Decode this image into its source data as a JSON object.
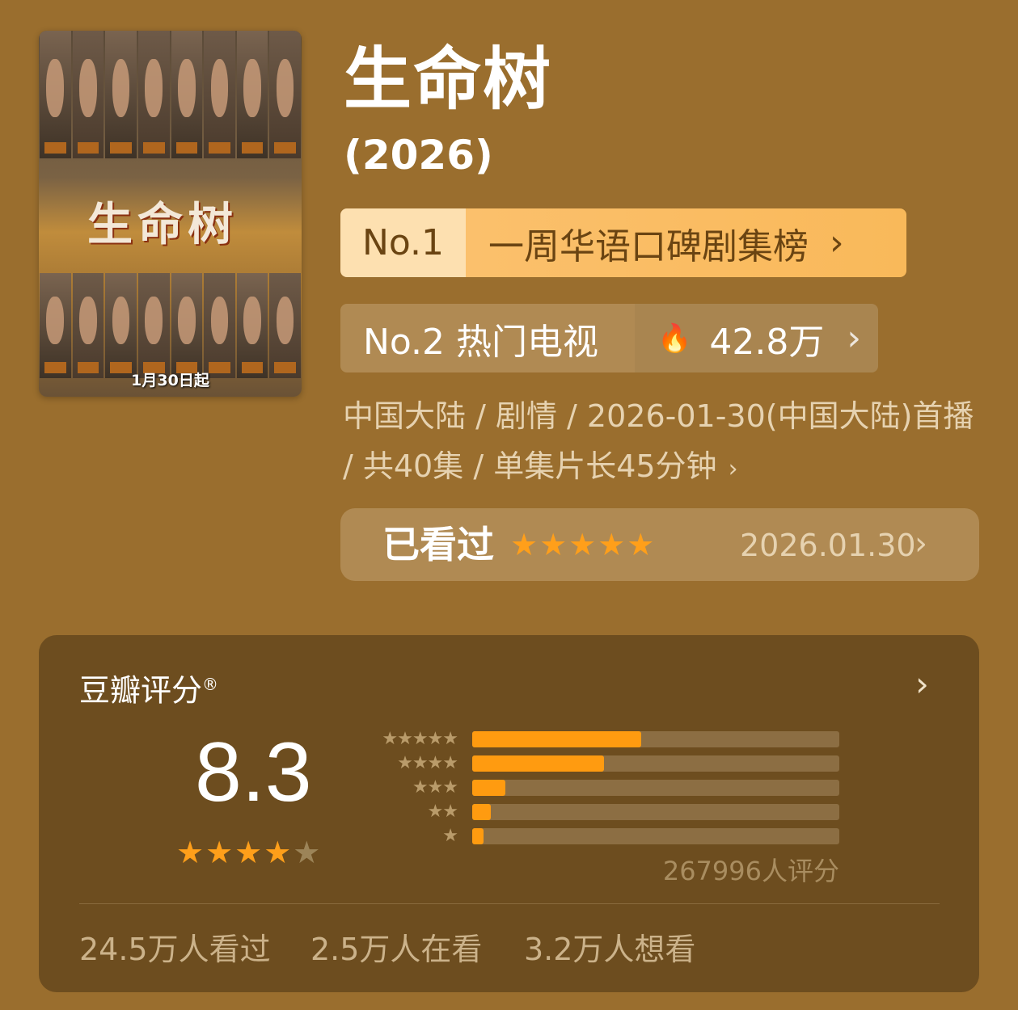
{
  "poster": {
    "title_art": "生命树",
    "date_text": "1月30日起"
  },
  "title": "生命树",
  "year": "(2026)",
  "rank1": {
    "no": "No.1",
    "label": "一周华语口碑剧集榜",
    "chevron": "›"
  },
  "rank2": {
    "label": "No.2 热门电视",
    "flame": "🔥",
    "heat": "42.8万",
    "chevron": "›"
  },
  "meta": {
    "text": "中国大陆 / 剧情 / 2026-01-30(中国大陆)首播 / 共40集 / 单集片长45分钟",
    "chevron": "›"
  },
  "watched": {
    "label": "已看过",
    "stars": "★★★★★",
    "rating": 5,
    "date": "2026.01.30",
    "chevron": "›"
  },
  "douban": {
    "title": "豆瓣评分",
    "registered": "®",
    "chevron": "›",
    "score": "8.3",
    "stars_on": "★★★★",
    "stars_off": "★",
    "distribution": [
      {
        "stars": "★★★★★",
        "percent": 46
      },
      {
        "stars": "★★★★",
        "percent": 36
      },
      {
        "stars": "★★★",
        "percent": 9
      },
      {
        "stars": "★★",
        "percent": 5
      },
      {
        "stars": "★",
        "percent": 3
      }
    ],
    "rating_count": "267996人评分",
    "stats": [
      "24.5万人看过",
      "2.5万人在看",
      "3.2万人想看"
    ]
  },
  "colors": {
    "background": "#9a6e2e",
    "card": "#6d4d1f",
    "accent": "#ff9b10",
    "badge1": "#fbc06c",
    "badge2": "#b08a53"
  }
}
